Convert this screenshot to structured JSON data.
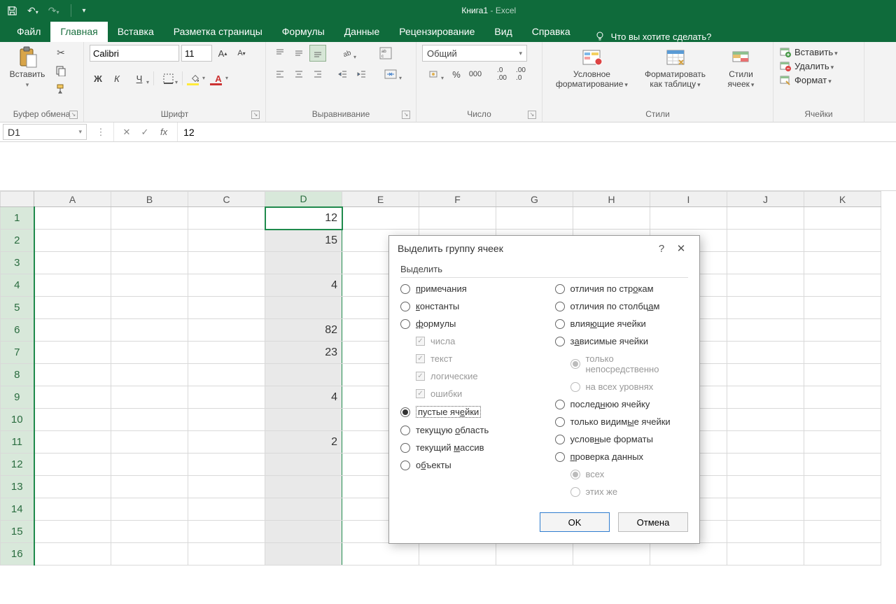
{
  "app": {
    "title": "Книга1",
    "subtitle": "Excel"
  },
  "qat": {
    "save": "Сохранить",
    "undo": "Отменить",
    "redo": "Повторить"
  },
  "tabs": {
    "file": "Файл",
    "home": "Главная",
    "insert": "Вставка",
    "layout": "Разметка страницы",
    "formulas": "Формулы",
    "data": "Данные",
    "review": "Рецензирование",
    "view": "Вид",
    "help": "Справка"
  },
  "tellme": "Что вы хотите сделать?",
  "ribbon": {
    "clipboard": {
      "label": "Буфер обмена",
      "paste": "Вставить"
    },
    "font": {
      "label": "Шрифт",
      "name": "Calibri",
      "size": "11"
    },
    "align": {
      "label": "Выравнивание"
    },
    "number": {
      "label": "Число",
      "format": "Общий"
    },
    "styles": {
      "label": "Стили",
      "cond": "Условное форматирование",
      "table": "Форматировать как таблицу",
      "cellstyles": "Стили ячеек"
    },
    "cells": {
      "label": "Ячейки",
      "insert": "Вставить",
      "delete": "Удалить",
      "format": "Формат"
    }
  },
  "namebox": "D1",
  "formula": "12",
  "columns": [
    "A",
    "B",
    "C",
    "D",
    "E",
    "F",
    "G",
    "H",
    "I",
    "J",
    "K"
  ],
  "rows": [
    "1",
    "2",
    "3",
    "4",
    "5",
    "6",
    "7",
    "8",
    "9",
    "10",
    "11",
    "12",
    "13",
    "14",
    "15",
    "16"
  ],
  "cells": {
    "D1": "12",
    "D2": "15",
    "D4": "4",
    "D6": "82",
    "D7": "23",
    "D9": "4",
    "D11": "2"
  },
  "dialog": {
    "title": "Выделить группу ячеек",
    "group": "Выделить",
    "left": [
      {
        "k": "notes",
        "label": "примечания",
        "u": [
          0,
          1
        ]
      },
      {
        "k": "const",
        "label": "константы",
        "u": [
          0,
          1
        ]
      },
      {
        "k": "formulas",
        "label": "формулы",
        "u": [
          0,
          1
        ]
      },
      {
        "k": "numbers",
        "label": "числа",
        "sub": true,
        "chk": true
      },
      {
        "k": "text",
        "label": "текст",
        "sub": true,
        "chk": true
      },
      {
        "k": "logical",
        "label": "логические",
        "sub": true,
        "chk": true
      },
      {
        "k": "errors",
        "label": "ошибки",
        "sub": true,
        "chk": true
      },
      {
        "k": "blanks",
        "label": "пустые ячейки",
        "u": [
          9,
          10
        ],
        "checked": true
      },
      {
        "k": "region",
        "label": "текущую область",
        "u": [
          8,
          9
        ]
      },
      {
        "k": "array",
        "label": "текущий массив",
        "u": [
          8,
          9
        ]
      },
      {
        "k": "objects",
        "label": "объекты",
        "u": [
          1,
          2
        ]
      }
    ],
    "right": [
      {
        "k": "rowdiff",
        "label": "отличия по строкам",
        "u": [
          14,
          15
        ]
      },
      {
        "k": "coldiff",
        "label": "отличия по столбцам",
        "u": [
          17,
          18
        ]
      },
      {
        "k": "prec",
        "label": "влияющие ячейки",
        "u": [
          4,
          5
        ]
      },
      {
        "k": "dep",
        "label": "зависимые ячейки",
        "u": [
          1,
          2
        ]
      },
      {
        "k": "direct",
        "label": "только непосредственно",
        "sub": true,
        "radio": true,
        "checked": true
      },
      {
        "k": "alllevels",
        "label": "на всех уровнях",
        "sub": true,
        "radio": true
      },
      {
        "k": "last",
        "label": "последнюю ячейку",
        "u": [
          6,
          7
        ]
      },
      {
        "k": "visible",
        "label": "только видимые ячейки",
        "u": [
          12,
          13
        ]
      },
      {
        "k": "cond",
        "label": "условные форматы",
        "u": [
          5,
          6
        ]
      },
      {
        "k": "valid",
        "label": "проверка данных",
        "u": [
          0,
          1
        ]
      },
      {
        "k": "all",
        "label": "всех",
        "sub": true,
        "radio": true,
        "checked": true
      },
      {
        "k": "same",
        "label": "этих же",
        "sub": true,
        "radio": true
      }
    ],
    "ok": "OK",
    "cancel": "Отмена"
  }
}
